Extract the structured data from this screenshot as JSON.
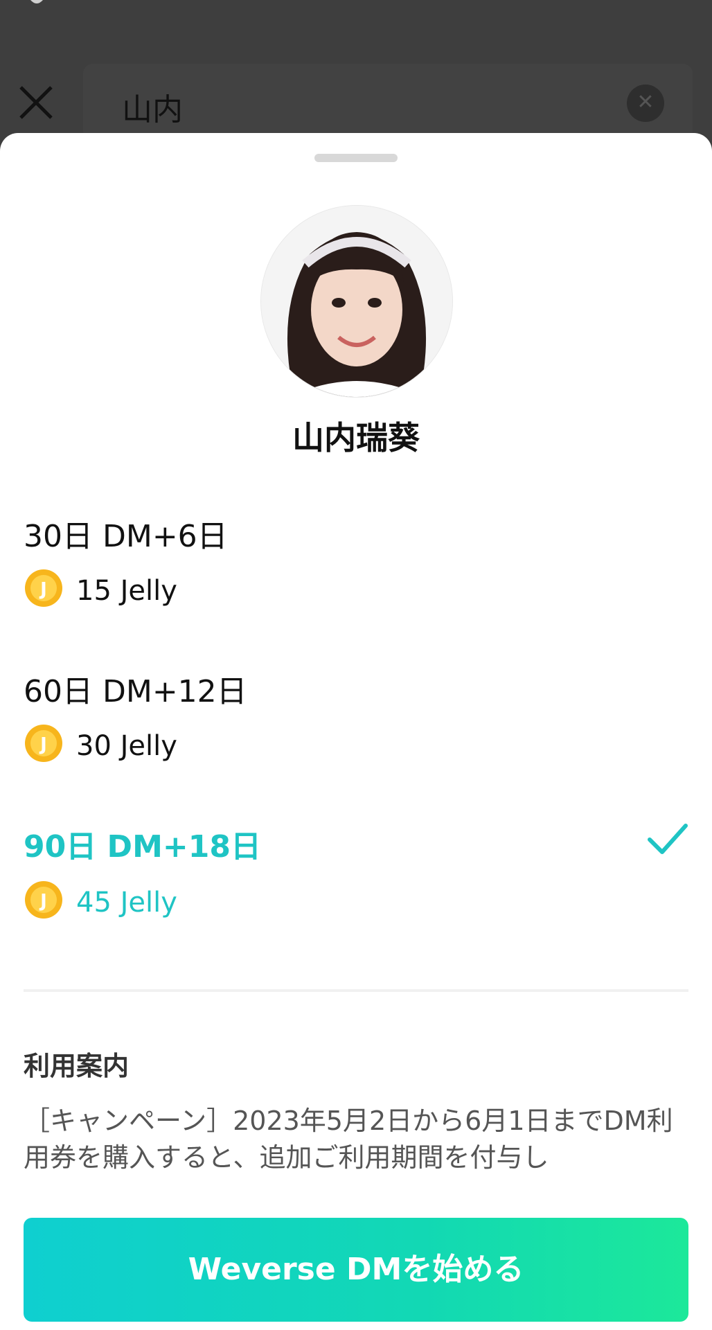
{
  "search": {
    "query": "山内"
  },
  "artist": {
    "name": "山内瑞葵"
  },
  "plans": [
    {
      "title": "30日 DM+6日",
      "price": "15 Jelly",
      "selected": false
    },
    {
      "title": "60日 DM+12日",
      "price": "30 Jelly",
      "selected": false
    },
    {
      "title": "90日 DM+18日",
      "price": "45 Jelly",
      "selected": true
    }
  ],
  "guide": {
    "title": "利用案内",
    "body": "［キャンペーン］2023年5月2日から6月1日までDM利用券を購入すると、追加ご利用期間を付与し"
  },
  "cta": {
    "label": "Weverse DMを始める"
  },
  "colors": {
    "accent": "#1fc4c4",
    "coin": "#f7b51c",
    "cta_start": "#0fcfd0",
    "cta_end": "#1ce89a"
  },
  "icons": {
    "close": "close-icon",
    "clear": "clear-icon",
    "coin": "jelly-coin-icon",
    "check": "check-icon"
  }
}
